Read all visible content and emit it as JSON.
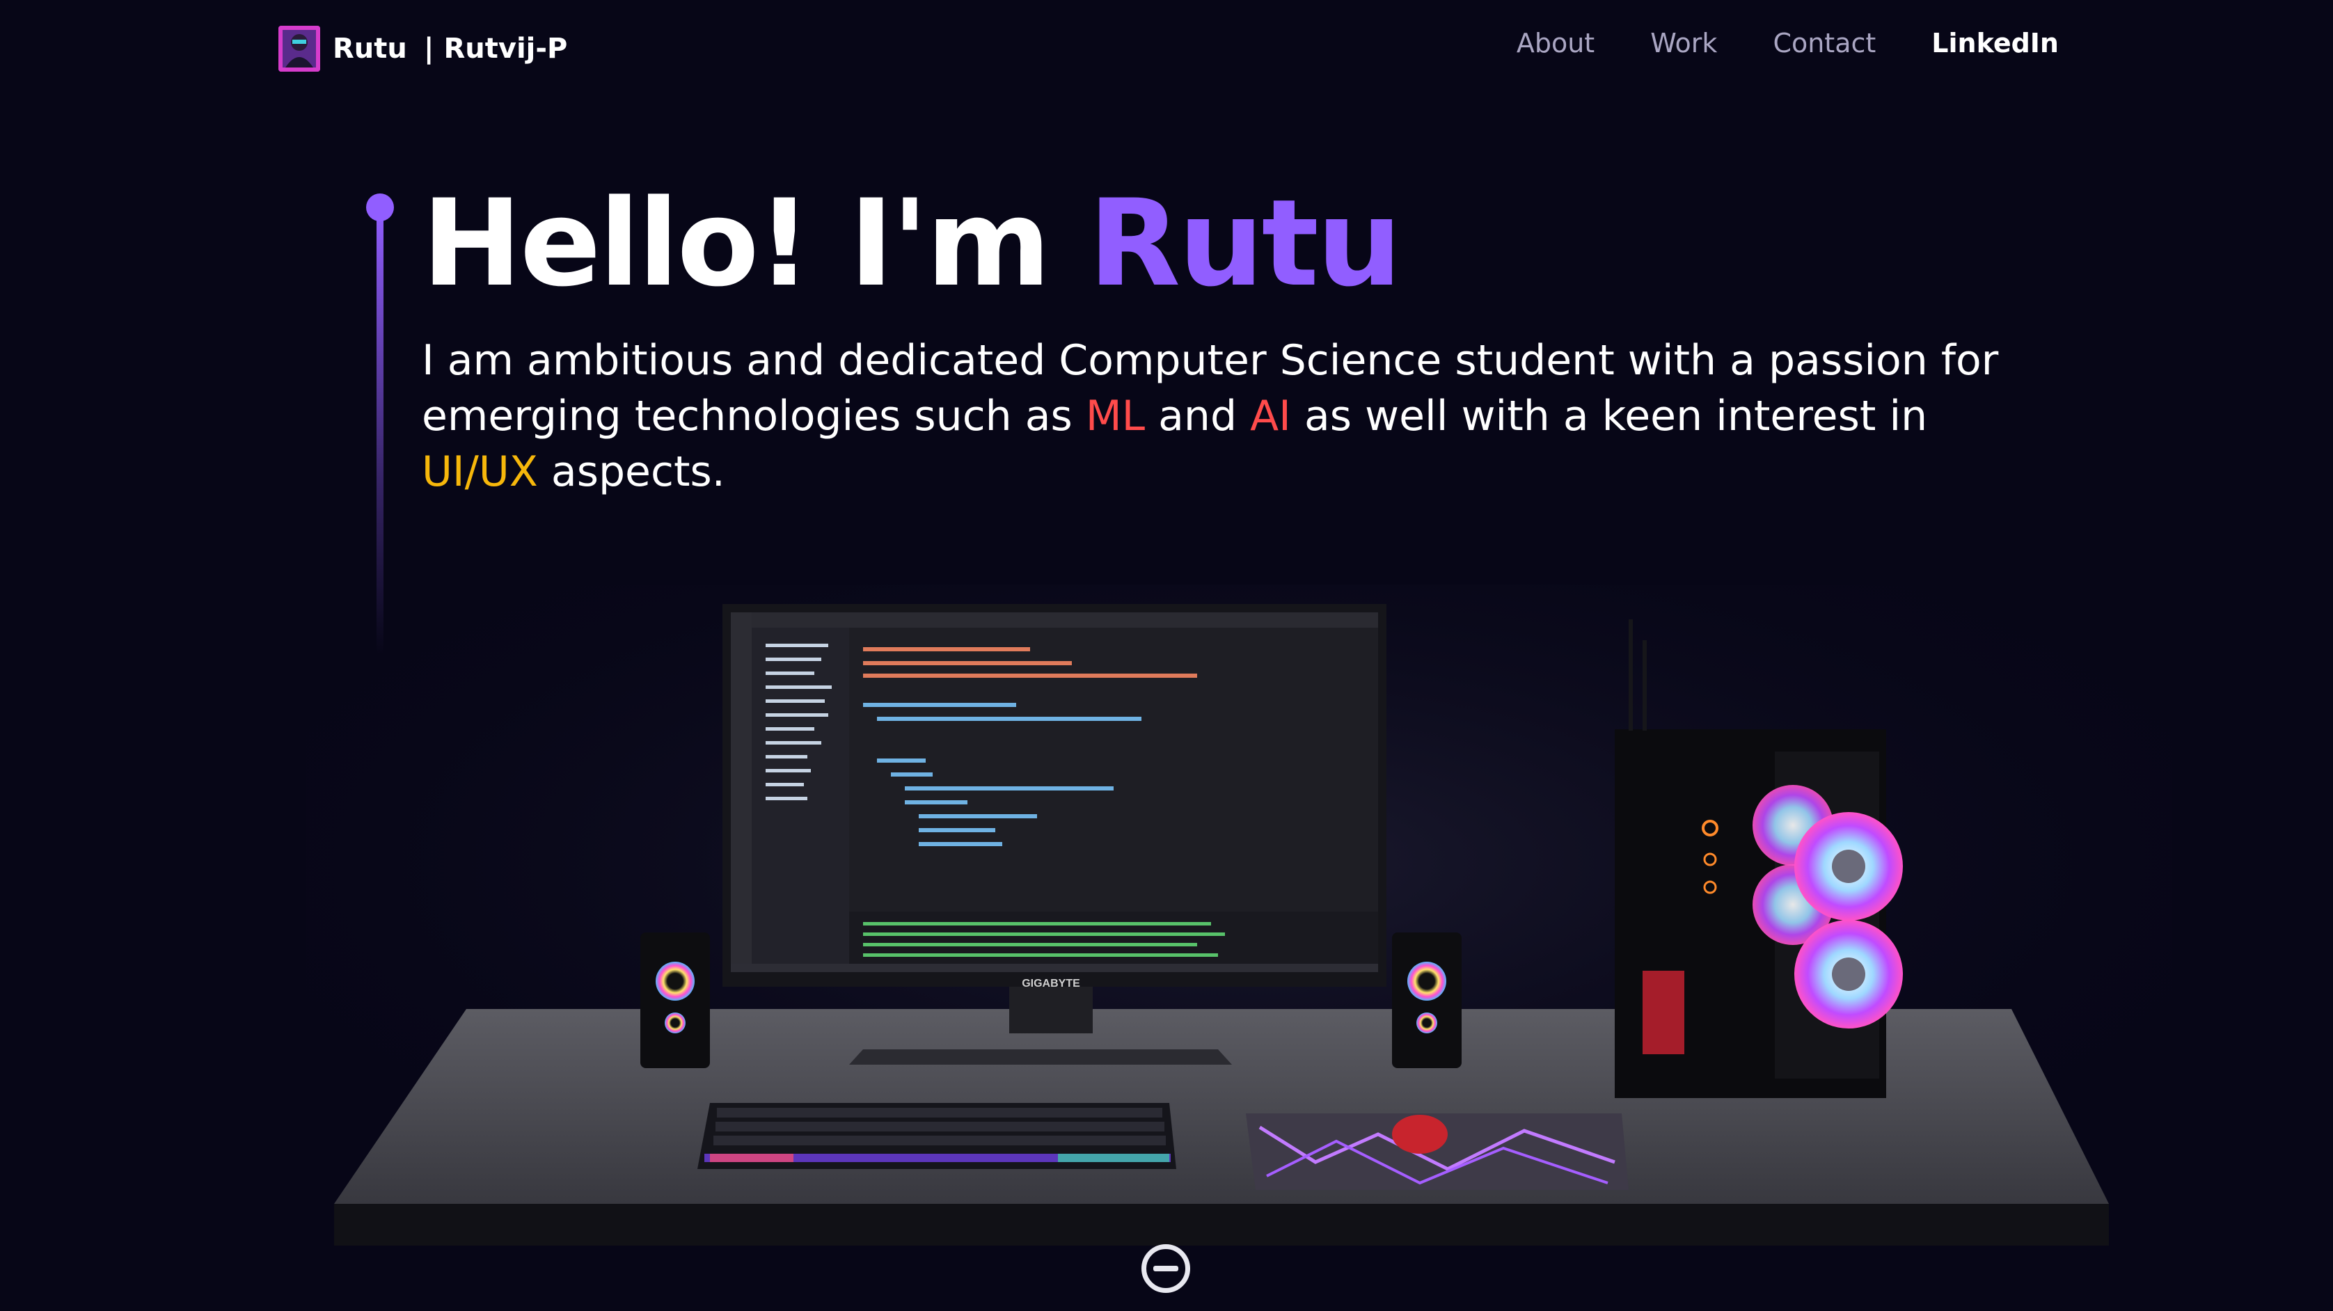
{
  "nav": {
    "name": "Rutu",
    "separator": "|",
    "handle": "Rutvij-P",
    "links": [
      {
        "label": "About",
        "active": false
      },
      {
        "label": "Work",
        "active": false
      },
      {
        "label": "Contact",
        "active": false
      },
      {
        "label": "LinkedIn",
        "active": true
      }
    ]
  },
  "hero": {
    "greeting": "Hello! I'm ",
    "name": "Rutu",
    "intro_part1": "I am ambitious and dedicated Computer Science student with a passion for emerging technologies such as ",
    "hl_ml": "ML",
    "intro_and": " and ",
    "hl_ai": "AI",
    "intro_part2": " as well with a keen interest in ",
    "hl_uiux": "UI/UX",
    "intro_part3": " aspects."
  },
  "scene": {
    "monitor_brand": "GIGABYTE"
  },
  "colors": {
    "background": "#070617",
    "accent": "#915eff",
    "highlight_red": "#ff4b4b",
    "highlight_yellow": "#f6b70b",
    "nav_muted": "#aaa6c3"
  },
  "icons": {
    "logo": "avatar-logo",
    "scroll": "scroll-down-icon"
  }
}
